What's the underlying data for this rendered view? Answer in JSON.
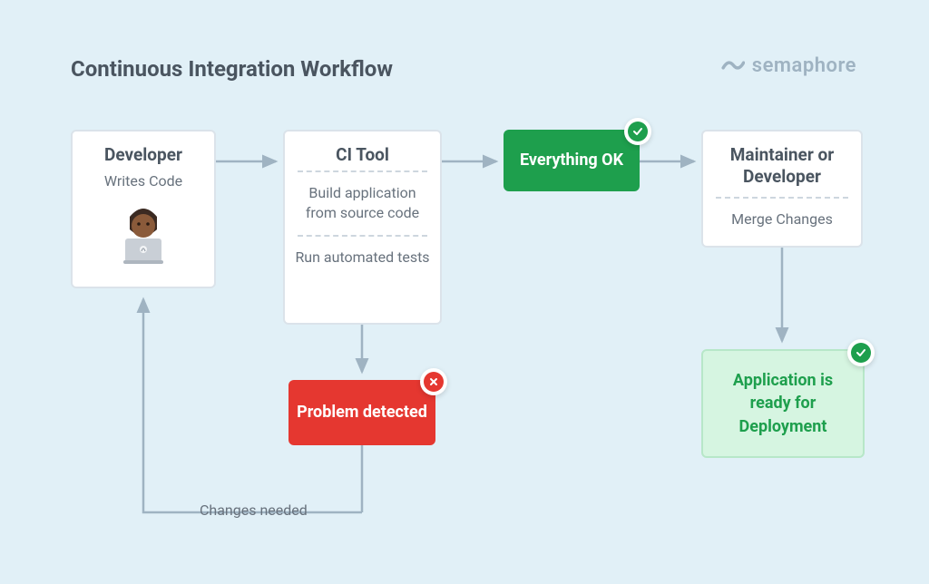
{
  "title": "Continuous Integration Workflow",
  "brand": "semaphore",
  "developer": {
    "title": "Developer",
    "subtitle": "Writes Code"
  },
  "ci_tool": {
    "title": "CI Tool",
    "step1": "Build application from source code",
    "step2": "Run automated tests"
  },
  "everything_ok": "Everything OK",
  "maintainer": {
    "title": "Maintainer or Developer",
    "subtitle": "Merge Changes"
  },
  "problem": "Problem detected",
  "ready": "Application is ready for Deployment",
  "changes_needed": "Changes needed"
}
